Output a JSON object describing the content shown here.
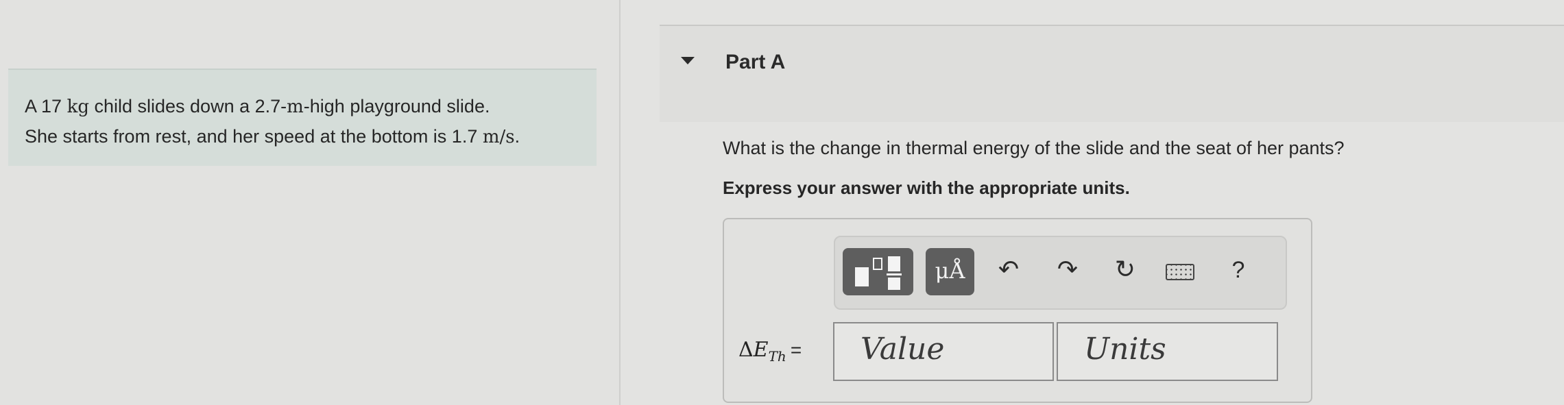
{
  "problem": {
    "line1": {
      "t1": "A 17 ",
      "u1": "kg",
      "t2": " child slides down a 2.7-",
      "u2": "m",
      "t3": "-high playground slide."
    },
    "line2": {
      "t1": "She starts from rest, and her speed at the bottom is 1.7 ",
      "u1": "m/s",
      "t2": "."
    }
  },
  "part": {
    "title": "Part A",
    "question": "What is the change in thermal energy of the slide and the seat of her pants?",
    "instruction": "Express your answer with the appropriate units."
  },
  "toolbar": {
    "units_label": "μÅ",
    "undo_icon": "undo-icon",
    "redo_icon": "redo-icon",
    "reset_icon": "reset-icon",
    "keyboard_icon": "keyboard-icon",
    "help_label": "?"
  },
  "answer": {
    "delta": "Δ",
    "var": "E",
    "sub": "Th",
    "equals": "=",
    "value_placeholder": "Value",
    "units_placeholder": "Units"
  }
}
